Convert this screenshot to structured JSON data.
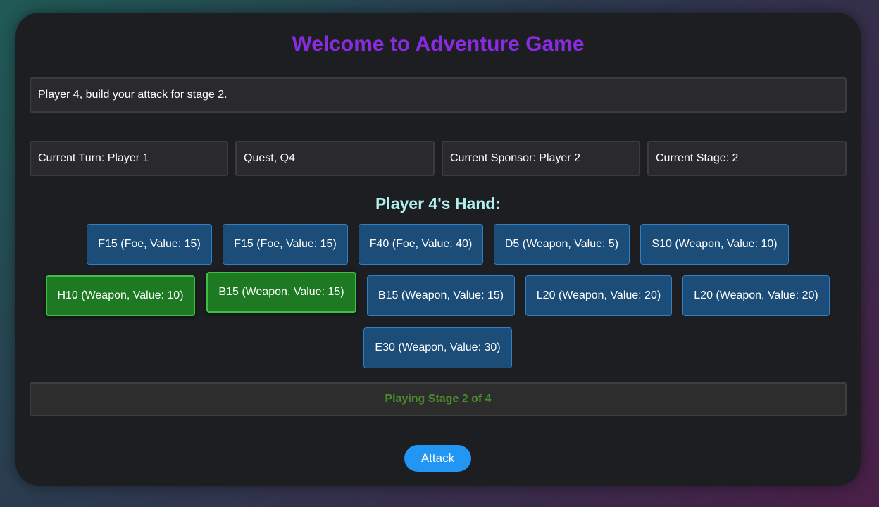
{
  "title": "Welcome to Adventure Game",
  "message": "Player 4, build your attack for stage 2.",
  "info": {
    "turn": "Current Turn: Player 1",
    "quest": "Quest, Q4",
    "sponsor": "Current Sponsor: Player 2",
    "stage": "Current Stage: 2"
  },
  "hand_title": "Player 4's Hand:",
  "cards": [
    {
      "label": "F15 (Foe, Value: 15)",
      "selected": false
    },
    {
      "label": "F15 (Foe, Value: 15)",
      "selected": false
    },
    {
      "label": "F40 (Foe, Value: 40)",
      "selected": false
    },
    {
      "label": "D5 (Weapon, Value: 5)",
      "selected": false
    },
    {
      "label": "S10 (Weapon, Value: 10)",
      "selected": false
    },
    {
      "label": "H10 (Weapon, Value: 10)",
      "selected": true
    },
    {
      "label": "B15 (Weapon, Value: 15)",
      "selected": true
    },
    {
      "label": "B15 (Weapon, Value: 15)",
      "selected": false
    },
    {
      "label": "L20 (Weapon, Value: 20)",
      "selected": false
    },
    {
      "label": "L20 (Weapon, Value: 20)",
      "selected": false
    },
    {
      "label": "E30 (Weapon, Value: 30)",
      "selected": false
    }
  ],
  "status": "Playing Stage 2 of 4",
  "attack_label": "Attack",
  "colors": {
    "title": "#8a2be2",
    "card": "#1b4d78",
    "card_selected": "#1e7a22",
    "status_text": "#4a8a2c",
    "attack_button": "#2196f3"
  }
}
